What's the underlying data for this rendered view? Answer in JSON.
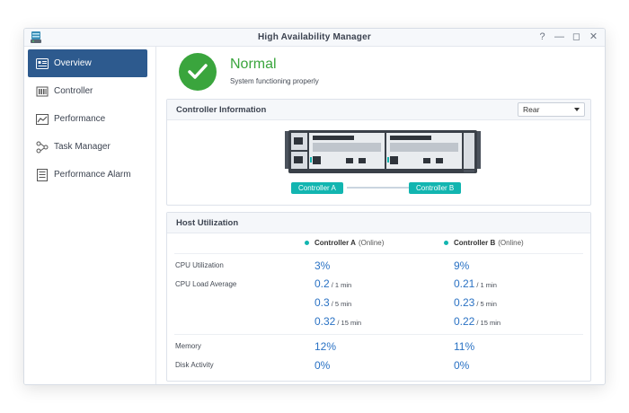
{
  "window": {
    "title": "High Availability Manager",
    "help": "?",
    "minimize": "—",
    "maximize": "◻",
    "close": "✕"
  },
  "sidebar": {
    "items": [
      {
        "label": "Overview",
        "active": true
      },
      {
        "label": "Controller"
      },
      {
        "label": "Performance"
      },
      {
        "label": "Task Manager"
      },
      {
        "label": "Performance Alarm"
      }
    ]
  },
  "status": {
    "title": "Normal",
    "subtitle": "System functioning properly",
    "color": "#3aa53d"
  },
  "controller_info": {
    "heading": "Controller Information",
    "view_select": "Rear",
    "controller_a": "Controller A",
    "controller_b": "Controller B",
    "tag_color": "#12b5b0"
  },
  "host_utilization": {
    "heading": "Host Utilization",
    "col_a": {
      "name": "Controller A",
      "state": "(Online)"
    },
    "col_b": {
      "name": "Controller B",
      "state": "(Online)"
    },
    "labels": {
      "cpu": "CPU Utilization",
      "load": "CPU Load Average",
      "memory": "Memory",
      "disk": "Disk Activity"
    },
    "a": {
      "cpu": "3%",
      "load1": "0.2",
      "load1_unit": "/ 1 min",
      "load5": "0.3",
      "load5_unit": "/ 5 min",
      "load15": "0.32",
      "load15_unit": "/ 15 min",
      "memory": "12%",
      "disk": "0%"
    },
    "b": {
      "cpu": "9%",
      "load1": "0.21",
      "load1_unit": "/ 1 min",
      "load5": "0.23",
      "load5_unit": "/ 5 min",
      "load15": "0.22",
      "load15_unit": "/ 15 min",
      "memory": "11%",
      "disk": "0%"
    }
  },
  "colors": {
    "accent": "#2d5a8e",
    "value": "#2a72c4"
  }
}
